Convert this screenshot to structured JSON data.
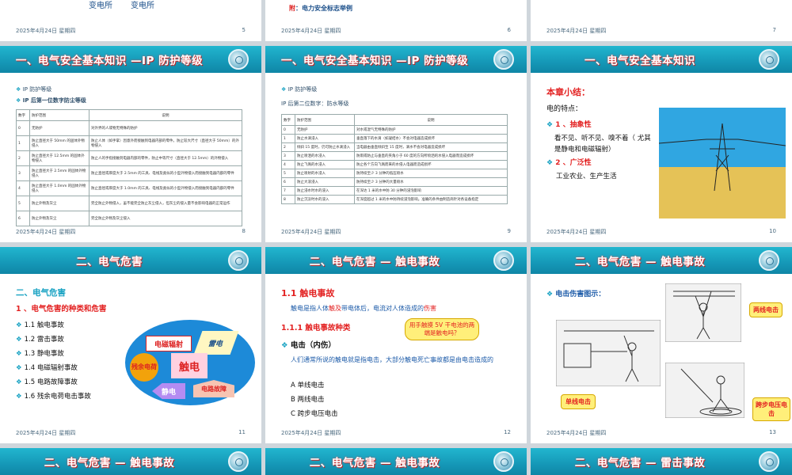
{
  "slide5": {
    "text1": "变电所",
    "text2": "变电所",
    "date": "2025年4月24日 星期四",
    "num": "5"
  },
  "slide6": {
    "label_prefix": "附",
    "label_text": "：电力安全标志举例",
    "date": "2025年4月24日 星期四",
    "num": "6"
  },
  "slide7": {
    "date": "2025年4月24日 星期四",
    "num": "7"
  },
  "slide8": {
    "title": "一、电气安全基本知识 —IP 防护等级",
    "bullet1": "IP 防护等级",
    "bullet2": "IP 后第一位数字防尘等级",
    "headers": [
      "数字",
      "防护范围",
      "说明"
    ],
    "rows": [
      [
        "0",
        "无防护",
        "对外界的人或物无特殊的防护"
      ],
      [
        "1",
        "防止直径大于 50mm 的固体外物侵入",
        "防止人体（如手掌）因意外而接触到电器内部的零件。防止较大尺寸（直径大于 50mm）的外物侵入"
      ],
      [
        "2",
        "防止直径大于 12.5mm 的固体外物侵入",
        "防止人的手指接触到电器内部的零件，防止中等尺寸（直径大于 12.5mm）的外物侵入"
      ],
      [
        "3",
        "防止直径大于 2.5mm 的固体外物侵入",
        "防止直径或厚度大于 2.5mm 的工具、电线及类似的小型外物侵入而接触到电器内部的零件"
      ],
      [
        "4",
        "防止直径大于 1.0mm 的固体外物侵入",
        "防止直径或厚度大于 1.0mm 的工具、电线及类似的小型外物侵入而接触到电器内部的零件"
      ],
      [
        "5",
        "防止外物及灰尘",
        "完全防止外物侵入，虽不能完全防止灰尘侵入，但灰尘的侵入量不会影响电器的正常运作"
      ],
      [
        "6",
        "防止外物及灰尘",
        "完全防止外物及灰尘侵入"
      ]
    ],
    "date": "2025年4月24日 星期四",
    "num": "8"
  },
  "slide9": {
    "title": "一、电气安全基本知识 —IP 防护等级",
    "bullet1": "IP 防护等级",
    "subtitle": "IP 后第二位数字：防水等级",
    "headers": [
      "数字",
      "防护范围",
      "说明"
    ],
    "rows": [
      [
        "0",
        "无防护",
        "对水或湿气无特殊的防护"
      ],
      [
        "1",
        "防止水滴浸入",
        "垂直落下的水滴（如凝结水）不会对电器造成损坏"
      ],
      [
        "2",
        "倾斜 15 度时，仍可防止水滴浸入",
        "当电器由垂直倾斜至 15 度时，滴水不会对电器造成损坏"
      ],
      [
        "3",
        "防止喷洒的水浸入",
        "防雨或防止与垂直的夹角小于 60 度的方向所喷洒的水侵入电器而造成损坏"
      ],
      [
        "4",
        "防止飞溅的水浸入",
        "防止各个方向飞溅而来的水侵入电器而造成损坏"
      ],
      [
        "5",
        "防止喷射的水浸入",
        "防持续至少 3 分钟的低压喷水"
      ],
      [
        "6",
        "防止大浪浸入",
        "防持续至少 3 分钟的大量喷水"
      ],
      [
        "7",
        "防止浸水时水的浸入",
        "在深达 1 米的水中防 30 分钟的浸泡影响"
      ],
      [
        "8",
        "防止沉没时水的浸入",
        "在深度超过 1 米的水中防持续浸泡影响。准确的条件由制造商针对各设备指定"
      ]
    ],
    "date": "2025年4月24日 星期四",
    "num": "9"
  },
  "slide10": {
    "title": "一、电气安全基本知识",
    "summary": "本章小结：",
    "feature": "电的特点：",
    "p1": "1 、抽象性",
    "p1_text": "看不见、听不见、嗅不着（ 尤其是静电和电磁辐射）",
    "p2": "2 、广泛性",
    "p2_text": "工业农业、生产生活",
    "date": "2025年4月24日 星期四",
    "num": "10"
  },
  "slide11": {
    "title": "二、电气危害",
    "h1": "二、电气危害",
    "h2": "1 、电气危害的种类和危害",
    "items": [
      "1.1 触电事故",
      "1.2 雷击事故",
      "1.3 静电事故",
      "1.4 电磁辐射事故",
      "1.5 电路故障事故",
      "1.6 残余电荷电击事故"
    ],
    "shapes": {
      "em": "电磁辐射",
      "lightning": "雷电",
      "residual": "残余电荷",
      "shock": "触电",
      "static": "静电",
      "fault": "电路故障"
    },
    "date": "2025年4月24日 星期四",
    "num": "11"
  },
  "slide12": {
    "title": "二、电气危害 — 触电事故",
    "h1": "1.1  触电事故",
    "def_a": "触电是指人体",
    "def_b": "触及",
    "def_c": "带电体后，电流对人体造成的",
    "def_d": "伤害",
    "h2": "1.1.1  触电事故种类",
    "bubble": "用手触摸 5V 干电池的两端是触电吗？",
    "b1": "电击（内伤）",
    "desc": "人们通常所说的触电就是指电击，大部分触电死亡事故都是由电击造成的",
    "list": [
      "A  单线电击",
      "B  两线电击",
      "C  跨步电压电击"
    ],
    "date": "2025年4月24日 星期四",
    "num": "12"
  },
  "slide13": {
    "title": "二、电气危害 — 触电事故",
    "b1": "电击伤害图示：",
    "tag1": "两线电击",
    "tag2": "单线电击",
    "tag3": "跨步电压电击",
    "date": "2025年4月24日 星期四",
    "num": "13"
  },
  "bottom": [
    "二、电气危害 — 触电事故",
    "二、电气危害 — 触电事故",
    "二、电气危害 — 雷击事故"
  ]
}
